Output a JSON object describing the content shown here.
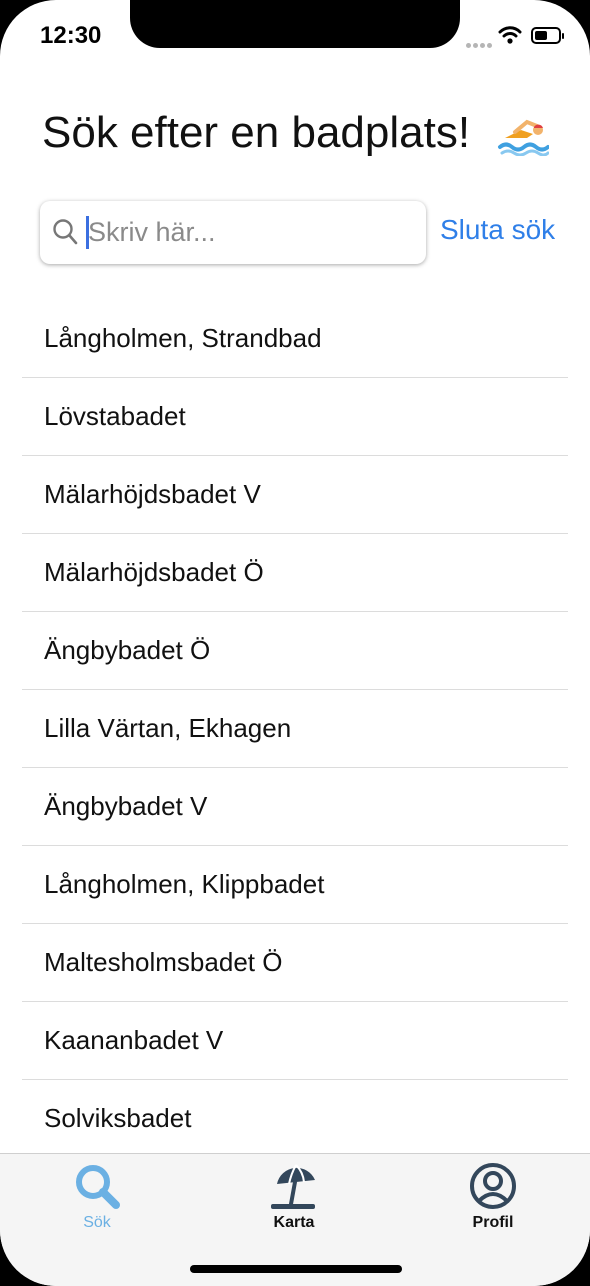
{
  "status_bar": {
    "time": "12:30"
  },
  "header": {
    "title": "Sök efter en badplats!",
    "emoji_icon": "swimmer-icon"
  },
  "search": {
    "placeholder": "Skriv här...",
    "value": "",
    "cancel_label": "Sluta sök"
  },
  "results": [
    "Långholmen, Strandbad",
    "Lövstabadet",
    "Mälarhöjdsbadet V",
    "Mälarhöjdsbadet Ö",
    "Ängbybadet Ö",
    "Lilla Värtan, Ekhagen",
    "Ängbybadet V",
    "Långholmen, Klippbadet",
    "Maltesholmsbadet Ö",
    "Kaananbadet V",
    "Solviksbadet"
  ],
  "tabbar": {
    "tabs": [
      {
        "label": "Sök",
        "icon": "search-icon",
        "active": true
      },
      {
        "label": "Karta",
        "icon": "beach-umbrella-icon",
        "active": false
      },
      {
        "label": "Profil",
        "icon": "user-circle-icon",
        "active": false
      }
    ]
  },
  "colors": {
    "accent": "#2f7fe8",
    "active_tab": "#6bb0e3",
    "text": "#111111"
  }
}
